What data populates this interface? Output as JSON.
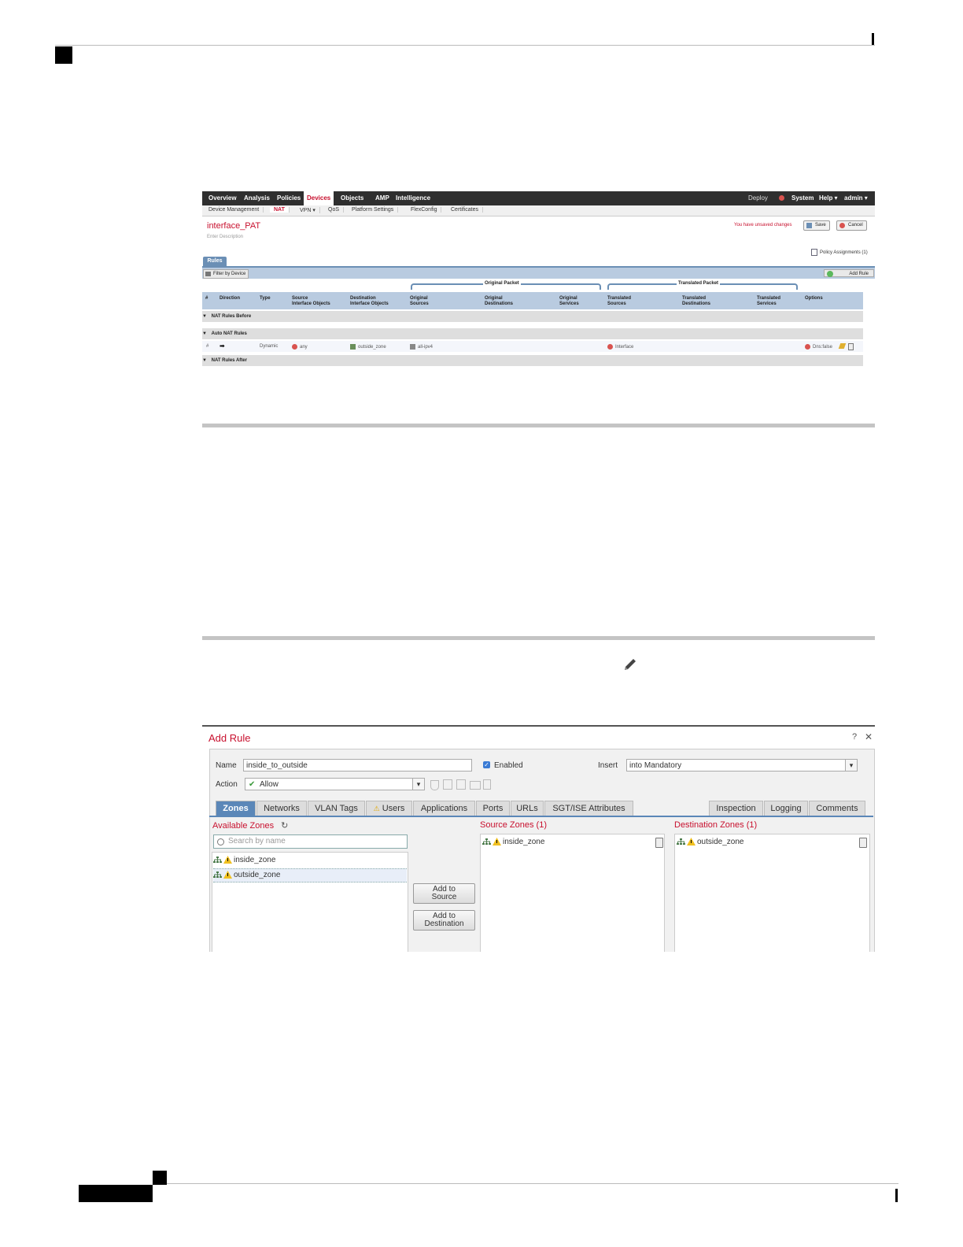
{
  "nat_screen": {
    "top_nav": [
      "Overview",
      "Analysis",
      "Policies",
      "Devices",
      "Objects",
      "AMP",
      "Intelligence"
    ],
    "active_top": "Devices",
    "top_right": {
      "deploy": "Deploy",
      "system": "System",
      "help": "Help ▾",
      "admin": "admin ▾"
    },
    "sub_nav": [
      "Device Management",
      "NAT",
      "VPN ▾",
      "QoS",
      "Platform Settings",
      "FlexConfig",
      "Certificates"
    ],
    "active_sub": "NAT",
    "policy_title": "interface_PAT",
    "policy_description": "Enter Description",
    "unsaved": "You have unsaved changes",
    "save": "Save",
    "cancel": "Cancel",
    "policy_assignments": "Policy Assignments (1)",
    "rules_tab": "Rules",
    "filter_by_device": "Filter by Device",
    "add_rule": "Add Rule",
    "original_packet": "Original Packet",
    "translated_packet": "Translated Packet",
    "columns": {
      "num": "#",
      "direction": "Direction",
      "type": "Type",
      "src_if_1": "Source",
      "src_if_2": "Interface Objects",
      "dst_if_1": "Destination",
      "dst_if_2": "Interface Objects",
      "orig_src_1": "Original",
      "orig_src_2": "Sources",
      "orig_dst_1": "Original",
      "orig_dst_2": "Destinations",
      "orig_svc_1": "Original",
      "orig_svc_2": "Services",
      "tr_src_1": "Translated",
      "tr_src_2": "Sources",
      "tr_dst_1": "Translated",
      "tr_dst_2": "Destinations",
      "tr_svc_1": "Translated",
      "tr_svc_2": "Services",
      "options": "Options"
    },
    "sections": {
      "before": "NAT Rules Before",
      "auto": "Auto NAT Rules",
      "after": "NAT Rules After"
    },
    "row": {
      "num": "#",
      "direction": "➡",
      "type": "Dynamic",
      "src_if": "any",
      "dst_if": "outside_zone",
      "orig_src": "all-ipv4",
      "tr_src": "Interface",
      "options": "Dns:false"
    }
  },
  "add_rule_screen": {
    "title": "Add Rule",
    "help": "?",
    "close": "✕",
    "name_label": "Name",
    "name_value": "inside_to_outside",
    "enabled_label": "Enabled",
    "enabled": true,
    "insert_label": "Insert",
    "insert_value": "into Mandatory",
    "action_label": "Action",
    "action_value": "Allow",
    "tabs_left": [
      "Zones",
      "Networks",
      "VLAN Tags",
      "Users",
      "Applications",
      "Ports",
      "URLs",
      "SGT/ISE Attributes"
    ],
    "tabs_right": [
      "Inspection",
      "Logging",
      "Comments"
    ],
    "active_tab": "Zones",
    "available_zones_label": "Available Zones",
    "search_placeholder": "Search by name",
    "available_zones": [
      "inside_zone",
      "outside_zone"
    ],
    "add_to_source": [
      "Add to",
      "Source"
    ],
    "add_to_destination": [
      "Add to",
      "Destination"
    ],
    "source_zones_label": "Source Zones (1)",
    "source_zones": [
      "inside_zone"
    ],
    "destination_zones_label": "Destination Zones (1)",
    "destination_zones": [
      "outside_zone"
    ]
  },
  "colors": {
    "accent_red": "#c8102e",
    "tab_blue": "#5b87b8",
    "nav_dark": "#2f2f2f"
  }
}
